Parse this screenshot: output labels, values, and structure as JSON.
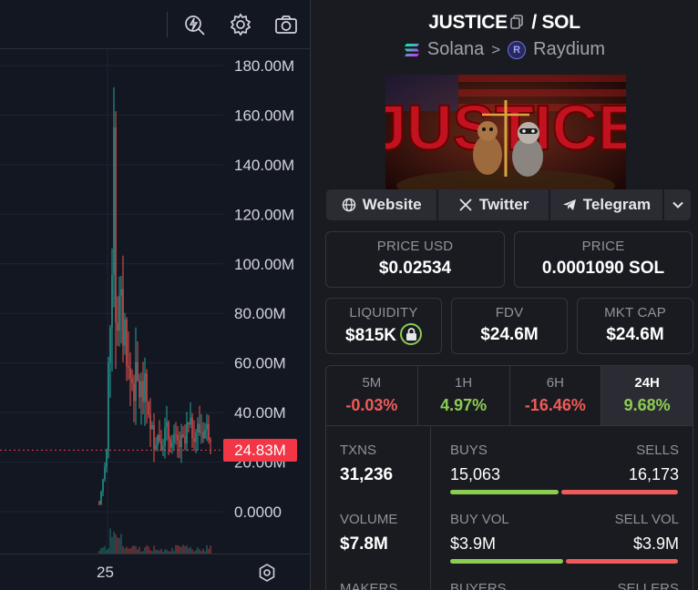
{
  "chart": {
    "y_axis_ticks": [
      "180.00M",
      "160.00M",
      "140.00M",
      "120.00M",
      "100.00M",
      "80.00M",
      "60.00M",
      "40.00M",
      "20.00M",
      "0.0000"
    ],
    "x_axis_tick": "25",
    "current_price_tag": "24.83M",
    "colors": {
      "up": "#26a69a",
      "down": "#ef5350",
      "tag": "#f23645"
    }
  },
  "pair": {
    "base": "JUSTICE",
    "quote": "SOL",
    "separator": "/",
    "chain": "Solana",
    "dex": "Raydium",
    "dex_logo_letter": "R"
  },
  "banner": {
    "text": "JUSTICE"
  },
  "links": {
    "website": "Website",
    "twitter": "Twitter",
    "telegram": "Telegram"
  },
  "stats": {
    "price_usd": {
      "label": "PRICE USD",
      "value": "$0.02534"
    },
    "price": {
      "label": "PRICE",
      "value": "0.0001090 SOL"
    },
    "liquidity": {
      "label": "LIQUIDITY",
      "value": "$815K"
    },
    "fdv": {
      "label": "FDV",
      "value": "$24.6M"
    },
    "mkt_cap": {
      "label": "MKT CAP",
      "value": "$24.6M"
    }
  },
  "timeframes": [
    {
      "label": "5M",
      "value": "-0.03%",
      "sign": "neg"
    },
    {
      "label": "1H",
      "value": "4.97%",
      "sign": "pos"
    },
    {
      "label": "6H",
      "value": "-16.46%",
      "sign": "neg"
    },
    {
      "label": "24H",
      "value": "9.68%",
      "sign": "pos",
      "active": true
    }
  ],
  "txns": {
    "txns_label": "TXNS",
    "txns_value": "31,236",
    "buys_label": "BUYS",
    "buys_value": "15,063",
    "sells_label": "SELLS",
    "sells_value": "16,173",
    "buys_fraction": 0.482,
    "volume_label": "VOLUME",
    "volume_value": "$7.8M",
    "buy_vol_label": "BUY VOL",
    "buy_vol_value": "$3.9M",
    "sell_vol_label": "SELL VOL",
    "sell_vol_value": "$3.9M",
    "buy_vol_fraction": 0.5,
    "makers_label": "MAKERS",
    "buyers_label": "BUYERS",
    "sellers_label": "SELLERS"
  }
}
